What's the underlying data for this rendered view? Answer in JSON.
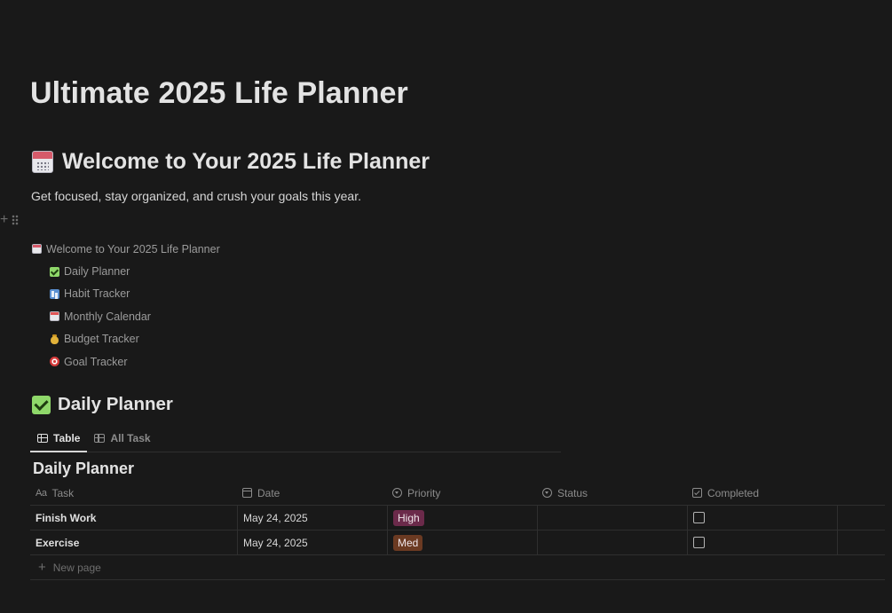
{
  "page": {
    "title": "Ultimate 2025 Life Planner"
  },
  "welcome": {
    "heading": "Welcome to Your 2025 Life Planner",
    "heading_icon": "calendar-icon",
    "subtitle": "Get focused, stay organized, and crush your goals this year."
  },
  "block_controls": {
    "add_icon": "plus-icon",
    "drag_icon": "drag-handle-icon",
    "add_glyph": "+"
  },
  "toc": {
    "items": [
      {
        "label": "Welcome to Your 2025 Life Planner",
        "icon": "calendar-icon",
        "level": 0
      },
      {
        "label": "Daily Planner",
        "icon": "check-mark-icon",
        "level": 1
      },
      {
        "label": "Habit Tracker",
        "icon": "bar-chart-icon",
        "level": 1
      },
      {
        "label": "Monthly Calendar",
        "icon": "calendar-icon",
        "level": 1
      },
      {
        "label": "Budget Tracker",
        "icon": "money-bag-icon",
        "level": 1
      },
      {
        "label": "Goal Tracker",
        "icon": "target-icon",
        "level": 1
      }
    ]
  },
  "daily_planner": {
    "heading": "Daily Planner",
    "heading_icon": "check-mark-icon",
    "tabs": [
      {
        "label": "Table",
        "icon": "table-icon",
        "active": true
      },
      {
        "label": "All Task",
        "icon": "table-icon",
        "active": false
      }
    ],
    "database_title": "Daily Planner",
    "columns": [
      {
        "label": "Task",
        "icon": "text-property-icon",
        "glyph": "Aa"
      },
      {
        "label": "Date",
        "icon": "calendar-property-icon"
      },
      {
        "label": "Priority",
        "icon": "select-property-icon"
      },
      {
        "label": "Status",
        "icon": "select-property-icon"
      },
      {
        "label": "Completed",
        "icon": "checkbox-property-icon"
      }
    ],
    "rows": [
      {
        "task": "Finish Work",
        "date": "May 24, 2025",
        "priority": "High",
        "priority_color": "#6b2a4a",
        "status": "",
        "completed": false
      },
      {
        "task": "Exercise",
        "date": "May 24, 2025",
        "priority": "Med",
        "priority_color": "#6b3a22",
        "status": "",
        "completed": false
      }
    ],
    "new_page_label": "New page",
    "new_page_glyph": "+"
  },
  "colors": {
    "background": "#191919",
    "text": "#d4d4d4",
    "muted": "#8c8c8c",
    "divider": "#2f2f2f"
  }
}
